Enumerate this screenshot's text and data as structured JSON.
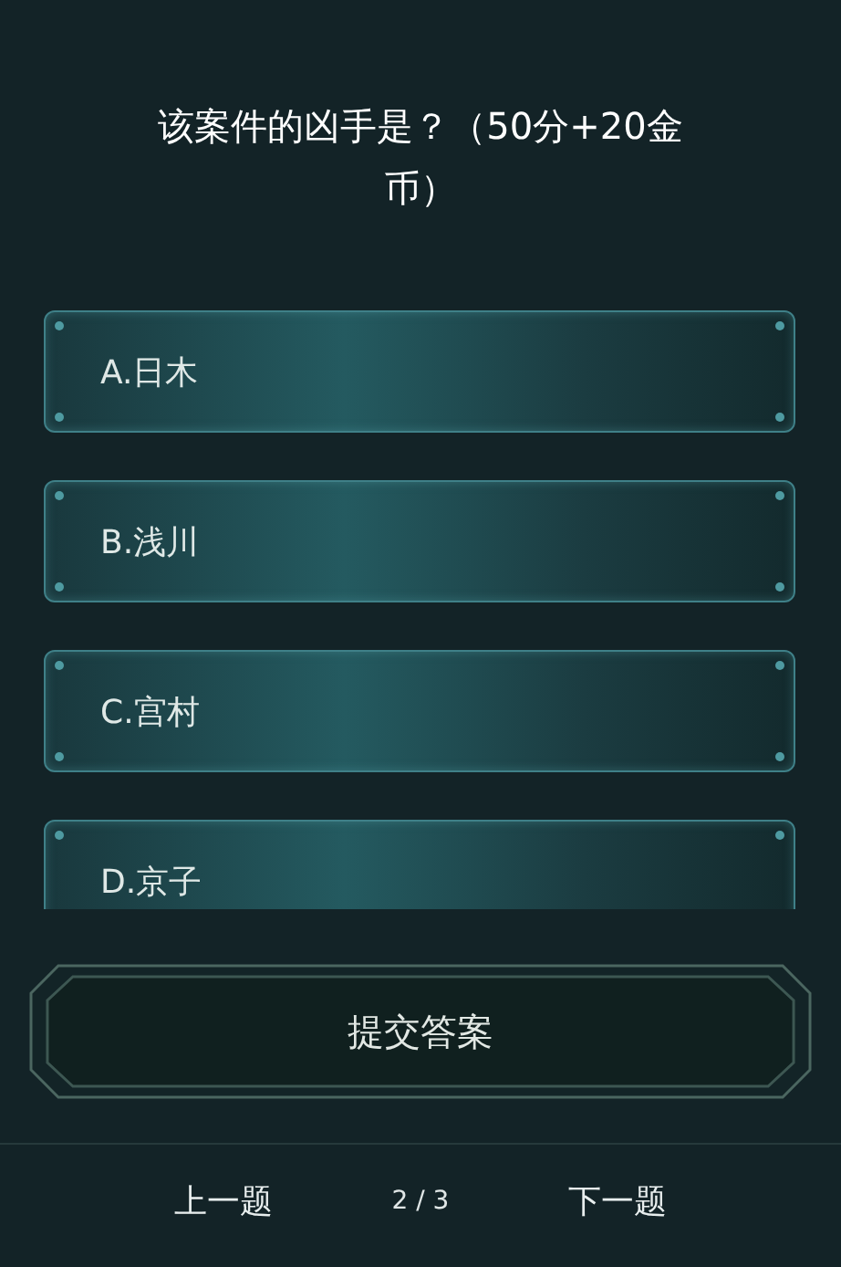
{
  "question": "该案件的凶手是？（50分+20金币）",
  "options": [
    {
      "label": "A.日木",
      "selected": false
    },
    {
      "label": "B.浅川",
      "selected": false
    },
    {
      "label": "C.宫村",
      "selected": false
    },
    {
      "label": "D.京子",
      "selected": false
    }
  ],
  "submit_button": "提交答案",
  "nav": {
    "prev": "上一题",
    "page": "2 / 3",
    "next": "下一题"
  }
}
